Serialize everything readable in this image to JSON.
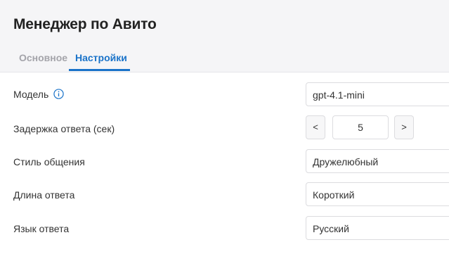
{
  "header": {
    "title": "Менеджер по Авито",
    "tabs": [
      {
        "label": "Основное",
        "active": false
      },
      {
        "label": "Настройки",
        "active": true
      }
    ]
  },
  "settings": {
    "model": {
      "label": "Модель",
      "value": "gpt-4.1-mini",
      "info_icon": "info-circle-icon"
    },
    "delay": {
      "label": "Задержка ответа (сек)",
      "value": "5",
      "decrement": "<",
      "increment": ">"
    },
    "style": {
      "label": "Стиль общения",
      "value": "Дружелюбный"
    },
    "length": {
      "label": "Длина ответа",
      "value": "Короткий"
    },
    "language": {
      "label": "Язык ответа",
      "value": "Русский"
    }
  },
  "colors": {
    "accent": "#1a73c9",
    "inactive_tab": "#a4a4aa",
    "header_bg": "#f5f5f7",
    "border": "#dcdcdf"
  }
}
